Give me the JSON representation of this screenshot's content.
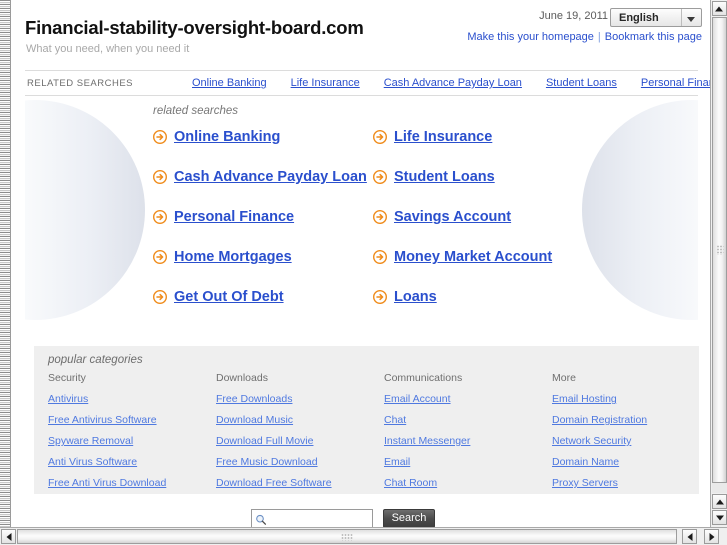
{
  "header": {
    "site_title": "Financial-stability-oversight-board.com",
    "tagline": "What you need, when you need it",
    "date": "June 19, 2011",
    "language": "English",
    "homepage_link": "Make this your homepage",
    "bookmark_link": "Bookmark this page",
    "link_separator": "|"
  },
  "related_searches_bar": {
    "label": "RELATED SEARCHES",
    "items": [
      "Online Banking",
      "Life Insurance",
      "Cash Advance Payday Loan",
      "Student Loans",
      "Personal Finance"
    ]
  },
  "related_searches": {
    "heading": "related searches",
    "rows": [
      {
        "left": "Online Banking",
        "right": "Life Insurance"
      },
      {
        "left": "Cash Advance Payday Loan",
        "right": "Student Loans"
      },
      {
        "left": "Personal Finance",
        "right": "Savings Account"
      },
      {
        "left": "Home Mortgages",
        "right": "Money Market Account"
      },
      {
        "left": "Get Out Of Debt",
        "right": "Loans"
      }
    ]
  },
  "popular_categories": {
    "heading": "popular categories",
    "columns": [
      {
        "title": "Security",
        "links": [
          "Antivirus",
          "Free Antivirus Software",
          "Spyware Removal",
          "Anti Virus Software",
          "Free Anti Virus Download"
        ]
      },
      {
        "title": "Downloads",
        "links": [
          "Free Downloads",
          "Download Music",
          "Download Full Movie",
          "Free Music Download",
          "Download Free Software"
        ]
      },
      {
        "title": "Communications",
        "links": [
          "Email Account",
          "Chat",
          "Instant Messenger",
          "Email",
          "Chat Room"
        ]
      },
      {
        "title": "More",
        "links": [
          "Email Hosting",
          "Domain Registration",
          "Network Security",
          "Domain Name",
          "Proxy Servers"
        ]
      }
    ]
  },
  "search": {
    "value": "",
    "placeholder": "",
    "button_label": "Search"
  },
  "colors": {
    "link": "#2a4fcd",
    "category_link": "#4f79e0",
    "accent_arrow": "#ef8c1c",
    "panel_bg": "#efefef",
    "search_button_bg": "#4c4c4c"
  }
}
